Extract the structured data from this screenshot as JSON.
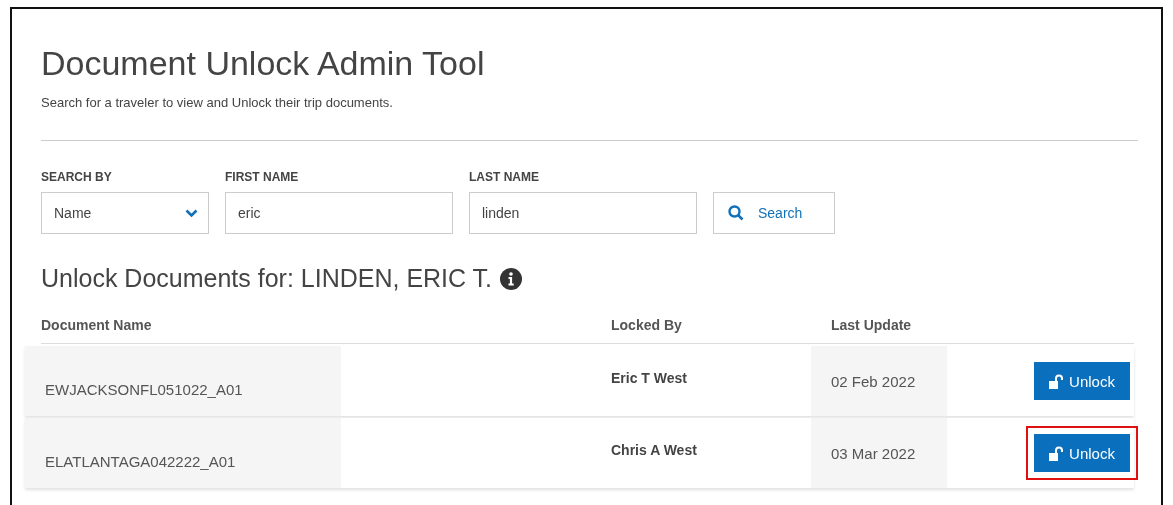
{
  "title": "Document Unlock Admin Tool",
  "subtitle": "Search for a traveler to view and Unlock their trip documents.",
  "search": {
    "fields": [
      {
        "kind": "select",
        "label": "SEARCH BY",
        "value": "Name"
      },
      {
        "kind": "text",
        "label": "FIRST NAME",
        "value": "eric"
      },
      {
        "kind": "text",
        "label": "LAST NAME",
        "value": "linden"
      }
    ],
    "button": "Search"
  },
  "results_heading": "Unlock Documents for: LINDEN, ERIC T.",
  "table": {
    "columns": [
      "Document Name",
      "Locked By",
      "Last Update"
    ],
    "rows": [
      {
        "document": "EWJACKSONFL051022_A01",
        "locked_by": "Eric T West",
        "last_update": "02 Feb 2022",
        "action": "Unlock",
        "highlighted": false
      },
      {
        "document": "ELATLANTAGA042222_A01",
        "locked_by": "Chris A West",
        "last_update": "03 Mar 2022",
        "action": "Unlock",
        "highlighted": true
      }
    ]
  }
}
